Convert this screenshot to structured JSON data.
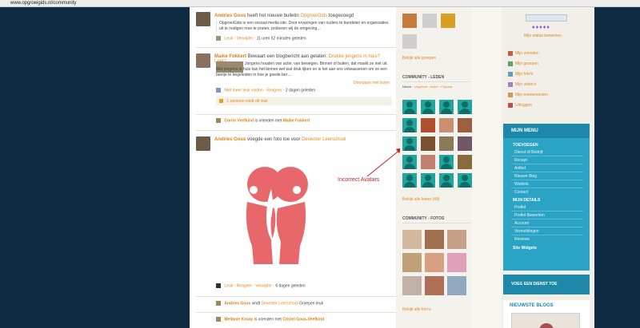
{
  "address_bar": {
    "url": "www.opgroeigids.nl/community"
  },
  "feed": {
    "item1": {
      "user": "Andries Gous",
      "text": "heeft het nieuwe bulletin",
      "target": "OpgroeiGids",
      "suffix": "toegevoegd",
      "body": "OpgroeiGids is een sociaal media site. Door ervaringen van ouders te bundelen en organisaties uit te nodigen mee te praten, proberen wij de omgeving…",
      "actions": [
        "Leuk",
        "Verwijder"
      ],
      "time": "11 uren 52 minuten geleden"
    },
    "item2": {
      "user": "Maike Fokkert",
      "text": "Bewaart een blogbericht aan gelaten:",
      "target": "Drukke jongens in huis? Leerz…",
      "body": "Jongens houden van actie, van bewegen. Binnen of buiten, dat maakt ze niet uit. Met jongens in huis kan het binnen wel wat druk lijken en is het aan ons volwassenen om ze een beetje te begeleiden in hoe je goede ber…",
      "more": "Doorgaan met lezen",
      "actions": [
        "Niet meer leuk vinden",
        "Reageer"
      ],
      "time": "2 dagen geleden",
      "likes": "1 persoon vindt dit leuk"
    },
    "item3": {
      "user": "Corrie Veefkind",
      "text": "is vrienden met",
      "target": "Maike Fokkert"
    },
    "item4": {
      "user": "Andries Gous",
      "text": "voegde een foto toe voor",
      "target": "Deventer Leerschool",
      "actions": [
        "Leuk",
        "Reageer",
        "Verwijder"
      ],
      "time": "6 dagen geleden"
    },
    "item5": {
      "user": "Andries Gous",
      "text": "vindt",
      "target": "Deventer Leerschool",
      "suffix": "Groepen leuk"
    },
    "item6": {
      "user": "Mellanie Kovac",
      "text": "is vrienden met",
      "target": "Cristel Gous-Veefkind"
    }
  },
  "annotation": {
    "label": "Incorrect Avatars"
  },
  "community": {
    "groups_link": "Bekijk alle groepen",
    "members_title": "COMMUNITY - LEDEN",
    "members_filters": [
      "Nieuw",
      "Uitgelicht",
      "Actief",
      "Populair"
    ],
    "members_link": "Bekijk alle leden (49)",
    "photos_title": "COMMUNITY - FOTOS",
    "photos_link": "Bekijk alle foto's"
  },
  "right": {
    "status_link": "Mijn status bewerken",
    "links": [
      "Mijn vrienden",
      "Mijn groepen",
      "Mijn foto's",
      "Mijn video's",
      "Mijn evenementen",
      "Uitloggen"
    ],
    "menu_title": "MIJN MENU",
    "menu_add_header": "TOEVOEGEN",
    "menu_add": [
      "Dienst of Bedrijf",
      "Recept",
      "Artikel",
      "Nieuwe Blog",
      "Weblink",
      "Contact"
    ],
    "menu_details_header": "MIJN DETAILS",
    "menu_details": [
      "Profiel",
      "Profiel Bewerken",
      "Account",
      "Vermeldingen",
      "Reviews"
    ],
    "menu_widgets": "Site Widgets",
    "add_service": "VOEG EEN DIENST TOE",
    "blogs_title": "NIEUWSTE BLOGS"
  },
  "colors": {
    "accent": "#e08a1e",
    "menu_blue": "#2aa3c4",
    "avatar_teal": "#1fa59b",
    "logo_red": "#e8676b"
  }
}
